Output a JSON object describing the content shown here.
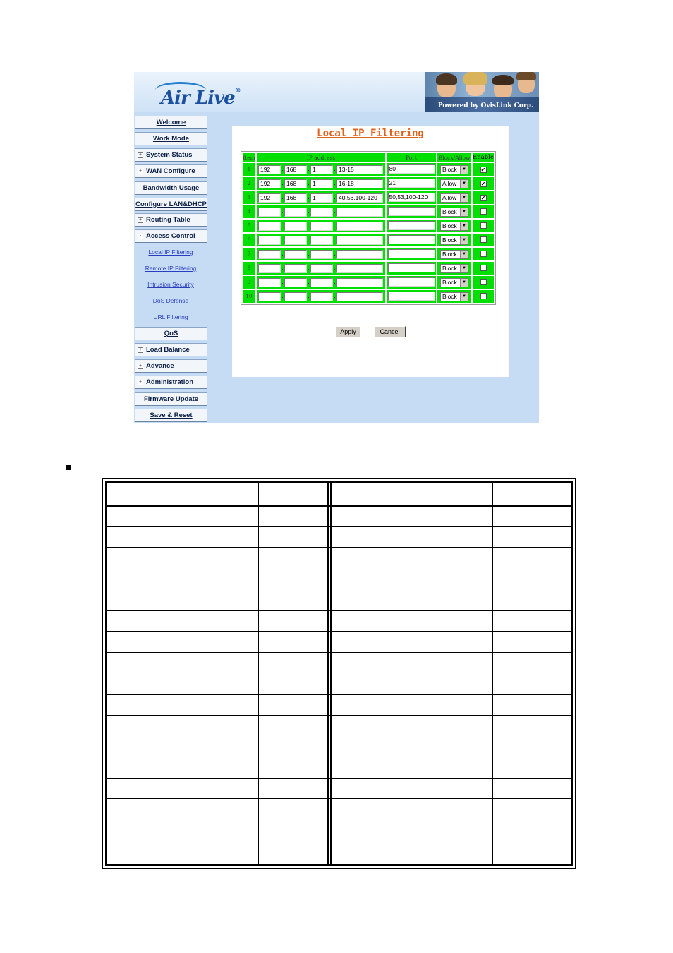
{
  "header": {
    "logo_text": "Air Live",
    "logo_reg": "®",
    "powered_by": "Powered by OvisLink Corp."
  },
  "menu": {
    "items": [
      {
        "label": "Welcome"
      },
      {
        "label": "Work Mode"
      },
      {
        "label": "System Status",
        "expander": "+"
      },
      {
        "label": "WAN Configure",
        "expander": "+"
      },
      {
        "label": "Bandwidth Usage"
      },
      {
        "label": "Configure LAN&DHCP"
      },
      {
        "label": "Routing Table",
        "expander": "+"
      },
      {
        "label": "Access Control",
        "expander": "-"
      },
      {
        "label": "QoS"
      },
      {
        "label": "Load Balance",
        "expander": "+"
      },
      {
        "label": "Advance",
        "expander": "+"
      },
      {
        "label": "Administration",
        "expander": "+"
      },
      {
        "label": "Firmware Update"
      },
      {
        "label": "Save & Reset"
      }
    ],
    "access_control_submenu": [
      "Local IP Filtering",
      "Remote IP Filtering",
      "Intrusion Security",
      "DoS Defense",
      "URL Filtering"
    ]
  },
  "panel": {
    "title": "Local IP Filtering",
    "columns": {
      "item": "Item",
      "ip": "IP address",
      "port": "Port",
      "block_allow": "Block/Allow",
      "enable": "Enable"
    },
    "rows": [
      {
        "item": "1",
        "ip": [
          "192",
          "168",
          "1",
          "13-15"
        ],
        "port": "80",
        "action": "Block",
        "enabled": "✔"
      },
      {
        "item": "2",
        "ip": [
          "192",
          "168",
          "1",
          "16-18"
        ],
        "port": "21",
        "action": "Allow",
        "enabled": "✔"
      },
      {
        "item": "3",
        "ip": [
          "192",
          "168",
          "1",
          "40,56,100-120"
        ],
        "port": "50,53,100-120",
        "action": "Allow",
        "enabled": "✔"
      },
      {
        "item": "4",
        "ip": [
          "",
          "",
          "",
          ""
        ],
        "port": "",
        "action": "Block",
        "enabled": ""
      },
      {
        "item": "5",
        "ip": [
          "",
          "",
          "",
          ""
        ],
        "port": "",
        "action": "Block",
        "enabled": ""
      },
      {
        "item": "6",
        "ip": [
          "",
          "",
          "",
          ""
        ],
        "port": "",
        "action": "Block",
        "enabled": ""
      },
      {
        "item": "7",
        "ip": [
          "",
          "",
          "",
          ""
        ],
        "port": "",
        "action": "Block",
        "enabled": ""
      },
      {
        "item": "8",
        "ip": [
          "",
          "",
          "",
          ""
        ],
        "port": "",
        "action": "Block",
        "enabled": ""
      },
      {
        "item": "9",
        "ip": [
          "",
          "",
          "",
          ""
        ],
        "port": "",
        "action": "Block",
        "enabled": ""
      },
      {
        "item": "10",
        "ip": [
          "",
          "",
          "",
          ""
        ],
        "port": "",
        "action": "Block",
        "enabled": ""
      }
    ],
    "apply_label": "Apply",
    "cancel_label": "Cancel",
    "dropdown_arrow": "▼"
  }
}
